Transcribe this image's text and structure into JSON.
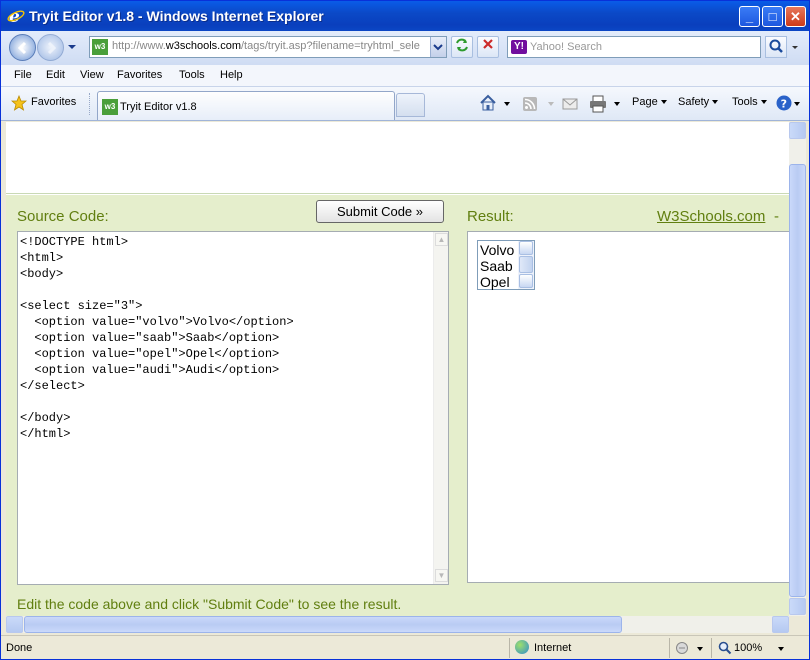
{
  "window": {
    "title": "Tryit Editor v1.8 - Windows Internet Explorer",
    "buttons": {
      "minimize": "_",
      "maximize": "□",
      "close": "✕"
    }
  },
  "navbar": {
    "address_domain_prefix": "http://www.",
    "address_domain": "w3schools.com",
    "address_path": "/tags/tryit.asp?filename=tryhtml_sele",
    "search_placeholder": "Yahoo! Search"
  },
  "menu": [
    "File",
    "Edit",
    "View",
    "Favorites",
    "Tools",
    "Help"
  ],
  "favbar": {
    "favorites_label": "Favorites",
    "tab_label": "Tryit Editor v1.8",
    "commands": [
      "Page",
      "Safety",
      "Tools"
    ]
  },
  "page": {
    "source_label": "Source Code:",
    "submit_label": "Submit Code »",
    "result_label": "Result:",
    "w3_link": "W3Schools.com",
    "w3_dash": "-",
    "code_lines": [
      "<!DOCTYPE html>",
      "<html>",
      "<body>",
      "",
      "<select size=\"3\">",
      "  <option value=\"volvo\">Volvo</option>",
      "  <option value=\"saab\">Saab</option>",
      "  <option value=\"opel\">Opel</option>",
      "  <option value=\"audi\">Audi</option>",
      "</select>",
      "",
      "</body>",
      "</html>"
    ],
    "result_options": [
      "Volvo",
      "Saab",
      "Opel"
    ],
    "hint": "Edit the code above and click \"Submit Code\" to see the result."
  },
  "status": {
    "text": "Done",
    "zone": "Internet",
    "zoom": "100%"
  }
}
